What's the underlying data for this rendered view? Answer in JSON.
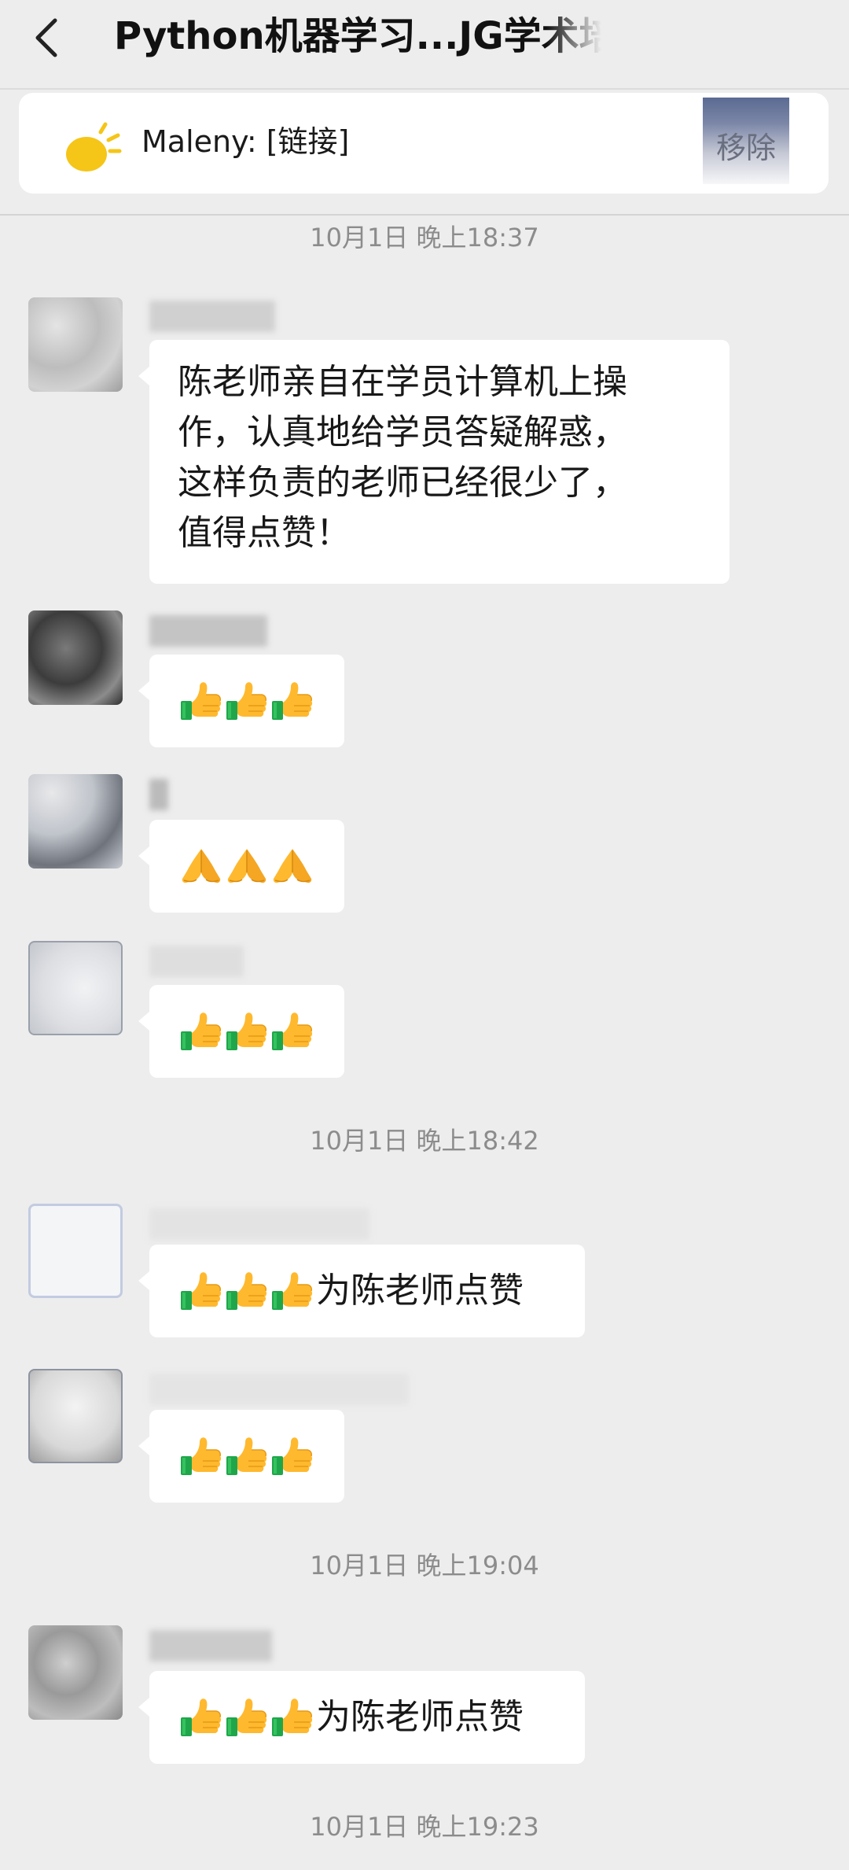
{
  "header": {
    "title": "Python机器学习...JG学术培训"
  },
  "pinned": {
    "text": "Maleny: [链接]",
    "remove_label": "移除"
  },
  "timestamps": [
    "10月1日 晚上18:37",
    "10月1日 晚上18:42",
    "10月1日 晚上19:04",
    "10月1日 晚上19:23"
  ],
  "messages": [
    {
      "sender": "",
      "text": [
        "陈老师亲自在学员计算机上操",
        "作，认真地给学员答疑解惑，",
        "这样负责的老师已经很少了，",
        "值得点赞！"
      ]
    },
    {
      "sender": "",
      "emojis": [
        "thumbs-up",
        "thumbs-up",
        "thumbs-up"
      ],
      "text": ""
    },
    {
      "sender": "",
      "emojis": [
        "folded-hands",
        "folded-hands",
        "folded-hands"
      ],
      "text": ""
    },
    {
      "sender": "",
      "emojis": [
        "thumbs-up",
        "thumbs-up",
        "thumbs-up"
      ],
      "text": ""
    },
    {
      "sender": "",
      "emojis": [
        "thumbs-up",
        "thumbs-up",
        "thumbs-up"
      ],
      "text": "为陈老师点赞"
    },
    {
      "sender": "",
      "emojis": [
        "thumbs-up",
        "thumbs-up",
        "thumbs-up"
      ],
      "text": ""
    },
    {
      "sender": "",
      "emojis": [
        "thumbs-up",
        "thumbs-up",
        "thumbs-up"
      ],
      "text": "为陈老师点赞"
    }
  ],
  "colors": {
    "background": "#ededed",
    "bubble": "#ffffff",
    "timestamp": "#8c8c8c",
    "sun": "#f5c518"
  }
}
